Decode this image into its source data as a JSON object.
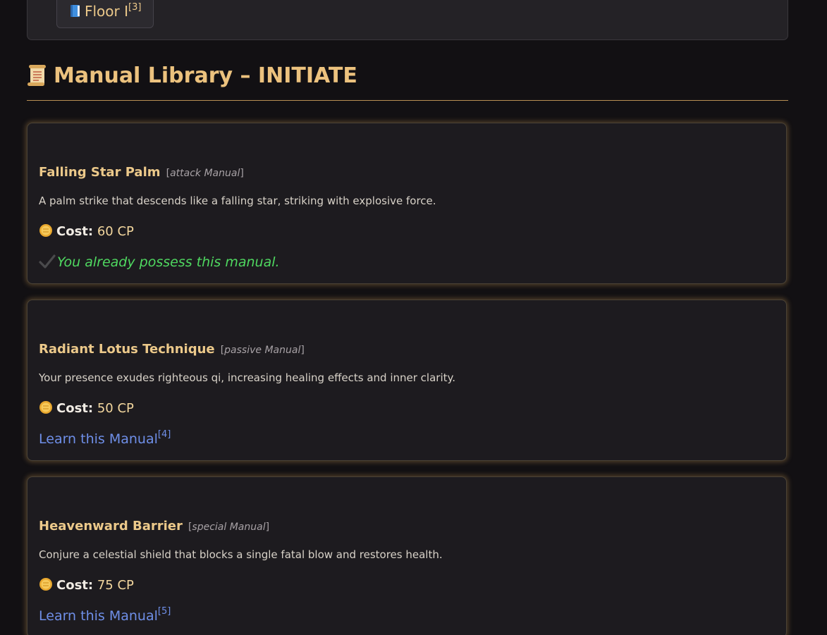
{
  "floor_nav": {
    "label": "Floor I",
    "ref": "[3]",
    "icon": "book-icon"
  },
  "section": {
    "title": "Manual Library – INITIATE",
    "icon": "scroll-icon"
  },
  "manuals": [
    {
      "name": "Falling Star Palm",
      "type_open": "[",
      "type": "attack Manual",
      "type_close": "]",
      "description": "A palm strike that descends like a falling star, striking with explosive force.",
      "cost_label": "Cost:",
      "cost_value": "60 CP",
      "status": "You already possess this manual.",
      "owned": true
    },
    {
      "name": "Radiant Lotus Technique",
      "type_open": "[",
      "type": "passive Manual",
      "type_close": "]",
      "description": "Your presence exudes righteous qi, increasing healing effects and inner clarity.",
      "cost_label": "Cost:",
      "cost_value": "50 CP",
      "action": "Learn this Manual",
      "ref": "[4]",
      "owned": false
    },
    {
      "name": "Heavenward Barrier",
      "type_open": "[",
      "type": "special Manual",
      "type_close": "]",
      "description": "Conjure a celestial shield that blocks a single fatal blow and restores health.",
      "cost_label": "Cost:",
      "cost_value": "75 CP",
      "action": "Learn this Manual",
      "ref": "[5]",
      "owned": false
    }
  ],
  "colors": {
    "background": "#121013",
    "card": "#1d1b1f",
    "accent_gold": "#ecc27e",
    "owned_green": "#4fd860",
    "link_blue": "#6f8fe8"
  }
}
